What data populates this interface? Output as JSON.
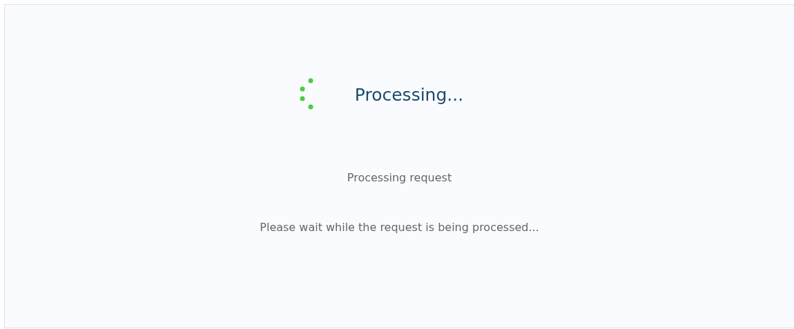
{
  "title": "Processing...",
  "status": "Processing request",
  "message": "Please wait while the request is being processed..."
}
